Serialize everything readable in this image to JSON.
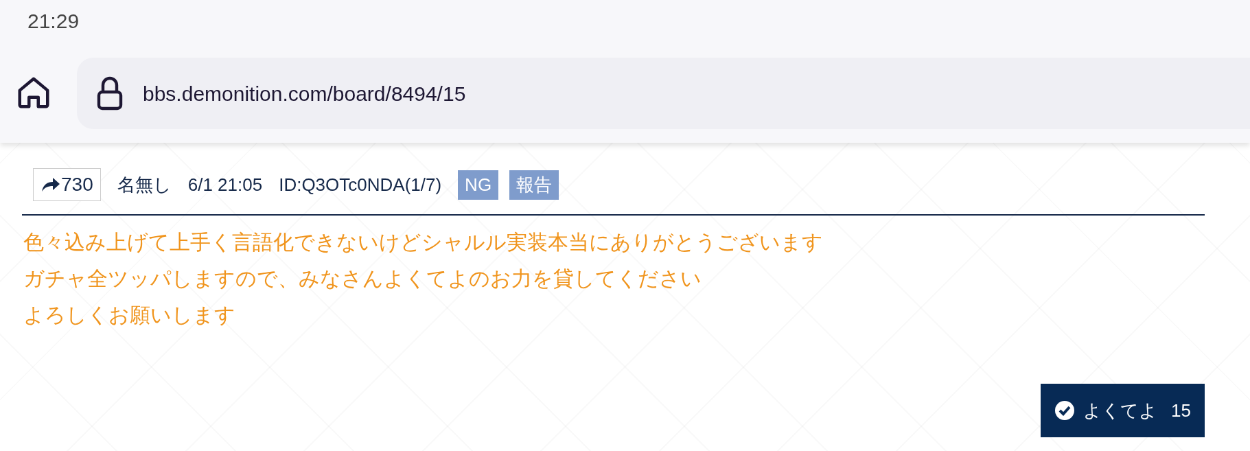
{
  "status_bar": {
    "time": "21:29"
  },
  "browser": {
    "url": "bbs.demonition.com/board/8494/15"
  },
  "post": {
    "reply_count": "730",
    "name": "名無し",
    "date": "6/1 21:05",
    "poster_id": "ID:Q3OTc0NDA(1/7)",
    "actions": [
      "NG",
      "報告"
    ],
    "body": [
      "色々込み上げて上手く言語化できないけどシャルル実装本当にありがとうございます",
      "ガチャ全ツッパしますので、みなさんよくてよのお力を貸してください",
      "よろしくお願いします"
    ],
    "like": {
      "label": "よくてよ",
      "count": "15"
    }
  }
}
